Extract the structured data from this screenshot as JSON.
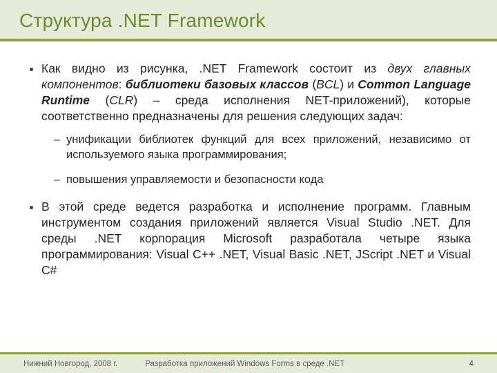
{
  "title": "Структура .NET Framework",
  "body": {
    "p1_a": "Как видно из рисунка, .NET Framework состоит из ",
    "p1_b": "двух главных компонентов",
    "p1_c": ": ",
    "p1_d": "библиотеки базовых классов",
    "p1_e": " (",
    "p1_f": "BCL",
    "p1_g": ") и ",
    "p1_h": "Common Language Runtime",
    "p1_i": " (",
    "p1_j": "CLR",
    "p1_k": ") – среда исполнения NET-приложений), которые соответственно предназначены для решения следующих задач:",
    "sub1": "унификации библиотек функций для всех приложений, независимо от используемого языка программирования;",
    "sub2": "повышения управляемости и безопасности кода",
    "p2": "В этой среде ведется разработка и исполнение программ. Главным инструментом создания приложений является Visual Studio .NET. Для среды .NET корпорация Microsoft разработала четыре языка программирования: Visual C++ .NET, Visual Basic .NET, JScript .NET и Visual C#"
  },
  "footer": {
    "location": "Нижний Новгород, 2008 г.",
    "course": "Разработка приложений Windows Forms в среде .NET",
    "page": "4"
  }
}
